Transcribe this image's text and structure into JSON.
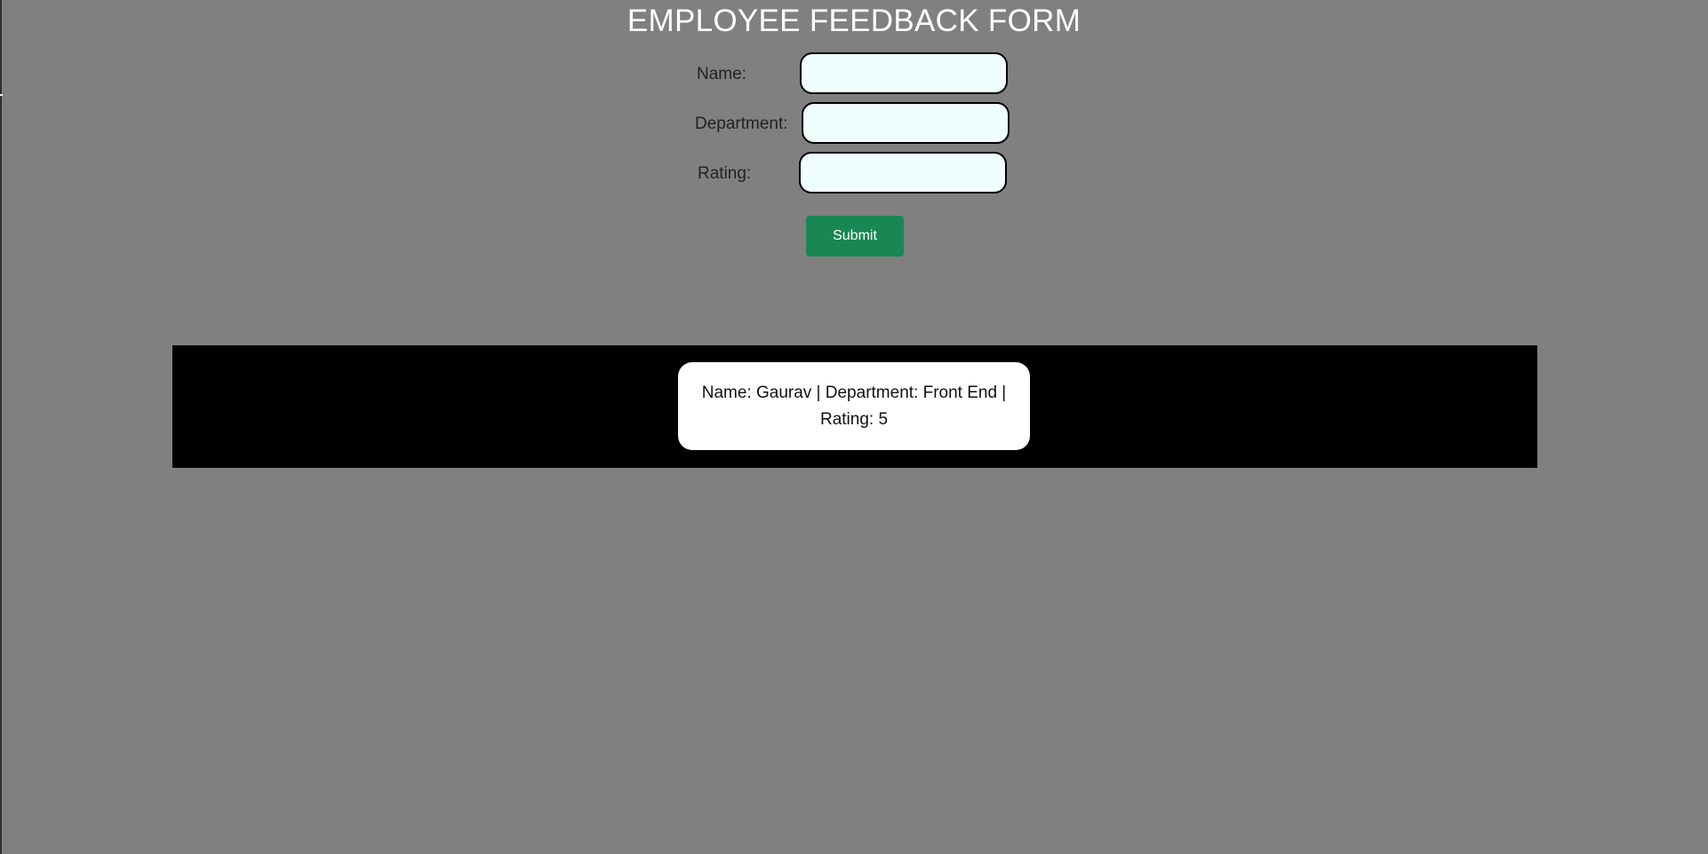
{
  "page": {
    "title": "EMPLOYEE FEEDBACK FORM",
    "background_color": "#808080"
  },
  "form": {
    "fields": [
      {
        "label": "Name:",
        "value": "",
        "placeholder": ""
      },
      {
        "label": "Department:",
        "value": "",
        "placeholder": ""
      },
      {
        "label": "Rating:",
        "value": "",
        "placeholder": ""
      }
    ],
    "submit_label": "Submit",
    "submit_color": "#198754",
    "input_background": "#effffe"
  },
  "results": {
    "background_color": "#000000",
    "entries": [
      {
        "text": "Name: Gaurav | Department: Front End | Rating: 5"
      }
    ]
  }
}
